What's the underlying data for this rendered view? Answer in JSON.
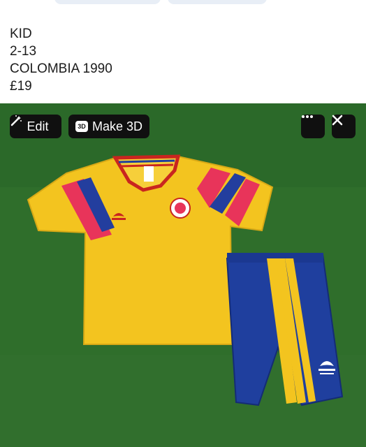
{
  "post": {
    "lines": [
      "KID",
      "2-13",
      "COLOMBIA 1990",
      "£19"
    ]
  },
  "toolbar": {
    "edit_label": "Edit",
    "make3d_label": "Make 3D",
    "badge_3d": "3D",
    "more_icon": "more-horizontal-icon",
    "close_icon": "close-icon",
    "edit_icon": "magic-wand-icon"
  },
  "photo": {
    "description_colors": {
      "background": "#2f6e2b",
      "shirt": "#f2c21e",
      "shorts": "#1f3f9e",
      "stripe_red": "#e8345a",
      "stripe_blue": "#233e9e"
    }
  }
}
